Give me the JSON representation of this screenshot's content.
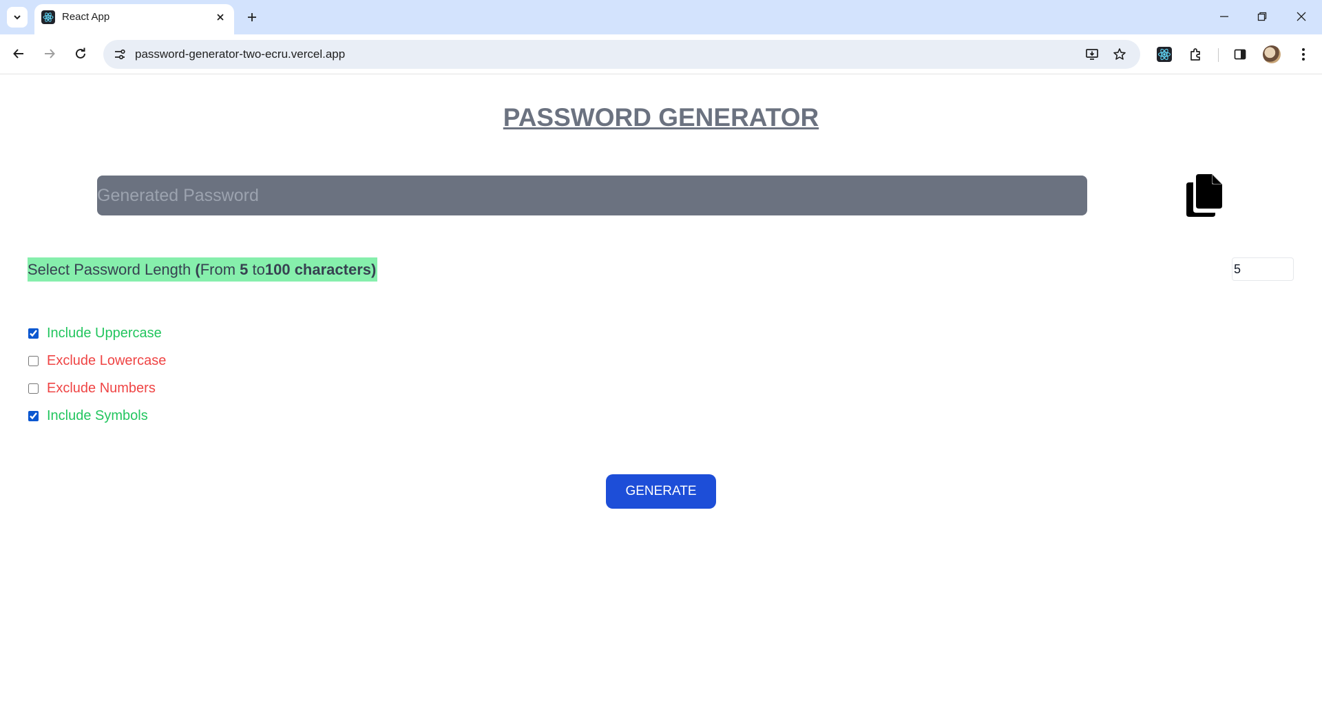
{
  "browser": {
    "tab_title": "React App",
    "url": "password-generator-two-ecru.vercel.app",
    "accent_color": "#d3e3fd"
  },
  "page": {
    "title": "PASSWORD GENERATOR",
    "password_placeholder": "Generated Password",
    "password_value": "",
    "length_label": {
      "prefix": "Select Password Length ",
      "open": "(",
      "from": "From ",
      "min": "5",
      "to": " to",
      "max_text": "100 characters",
      "close": ")"
    },
    "length_value": "5",
    "options": [
      {
        "label": "Include Uppercase",
        "checked": true,
        "color": "#22c55e"
      },
      {
        "label": "Exclude Lowercase",
        "checked": false,
        "color": "#ef4444"
      },
      {
        "label": "Exclude Numbers",
        "checked": false,
        "color": "#ef4444"
      },
      {
        "label": "Include Symbols",
        "checked": true,
        "color": "#22c55e"
      }
    ],
    "generate_label": "GENERATE",
    "colors": {
      "title": "#6b7280",
      "field_bg": "#6b7280",
      "highlight": "#86efac",
      "button": "#1d4ed8"
    }
  },
  "icons": [
    "chevron-down-icon",
    "react-logo-icon",
    "close-icon",
    "plus-icon",
    "minimize-icon",
    "restore-icon",
    "back-icon",
    "forward-icon",
    "reload-icon",
    "site-info-icon",
    "install-icon",
    "star-icon",
    "extensions-icon",
    "side-panel-icon",
    "menu-icon",
    "copy-icon"
  ]
}
